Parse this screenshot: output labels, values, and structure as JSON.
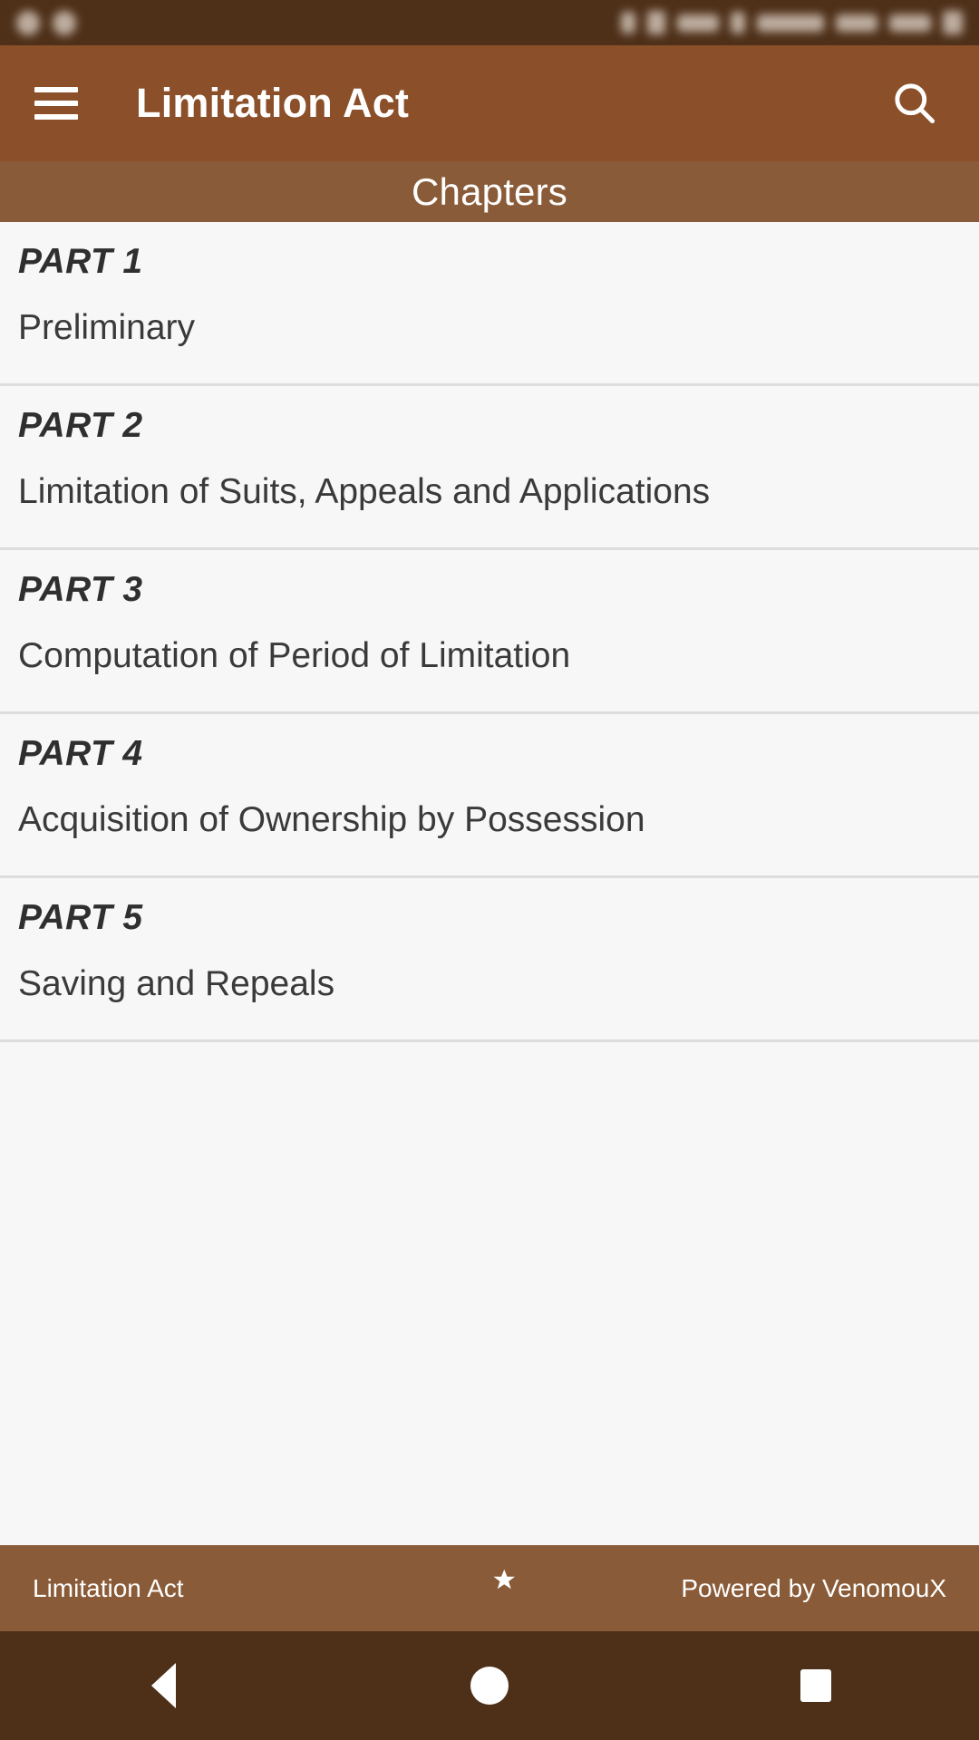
{
  "status_bar": {
    "blurred": true,
    "background": "#4e3019",
    "left_icons": [
      "notification-icon",
      "notification-icon"
    ],
    "right_icons": [
      "bluetooth-icon",
      "vibrate-icon",
      "battery-percent-text",
      "alarm-icon",
      "wifi-icon",
      "signal-icon",
      "clock-text",
      "battery-icon"
    ]
  },
  "app_bar": {
    "background": "#8b502a",
    "menu_icon": "hamburger-menu-icon",
    "title": "Limitation Act",
    "search_icon": "search-icon"
  },
  "section_header": {
    "label": "Chapters",
    "background": "#8a5b38"
  },
  "chapters": [
    {
      "part": "PART 1",
      "name": "Preliminary"
    },
    {
      "part": "PART 2",
      "name": "Limitation of Suits, Appeals and Applications"
    },
    {
      "part": "PART 3",
      "name": "Computation of Period of Limitation"
    },
    {
      "part": "PART 4",
      "name": "Acquisition of Ownership by Possession"
    },
    {
      "part": "PART 5",
      "name": "Saving and Repeals"
    }
  ],
  "footer": {
    "left_label": "Limitation Act",
    "logo_icon": "crescent-moon-star-icon",
    "right_label": "Powered by VenomouX",
    "background": "#8a5b38"
  },
  "nav_bar": {
    "background": "#4e3019",
    "back_icon": "back-triangle-icon",
    "home_icon": "home-circle-icon",
    "recents_icon": "recents-square-icon"
  },
  "theme": {
    "primary": "#8b502a",
    "primary_light": "#8a5b38",
    "primary_dark": "#4e3019",
    "list_background": "#f7f7f7",
    "divider": "#dddddd",
    "text_on_primary": "#ffffff",
    "text_primary": "#2f2f2f"
  }
}
